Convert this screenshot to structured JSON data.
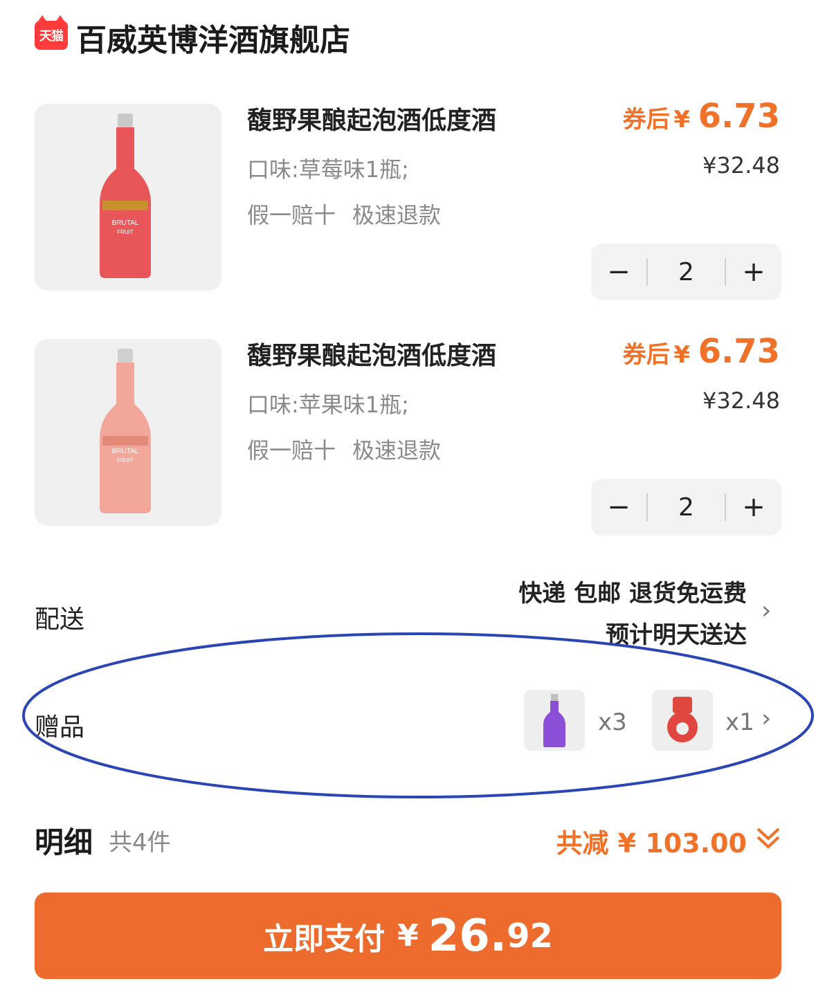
{
  "store": {
    "logo_text": "天猫",
    "name": "百威英博洋酒旗舰店"
  },
  "items": [
    {
      "title": "馥野果酿起泡酒低度酒",
      "flavor": "口味:草莓味1瓶;",
      "services": [
        "假一赔十",
        "极速退款"
      ],
      "coupon_label": "券后",
      "currency": "¥",
      "coupon_price": "6.73",
      "original_price": "¥32.48",
      "quantity": "2",
      "minus": "−",
      "plus": "+",
      "bottle_color": "#e8565a",
      "bottle_label": "BRUTAL"
    },
    {
      "title": "馥野果酿起泡酒低度酒",
      "flavor": "口味:苹果味1瓶;",
      "services": [
        "假一赔十",
        "极速退款"
      ],
      "coupon_label": "券后",
      "currency": "¥",
      "coupon_price": "6.73",
      "original_price": "¥32.48",
      "quantity": "2",
      "minus": "−",
      "plus": "+",
      "bottle_color": "#f2a79a",
      "bottle_label": "BRUTAL"
    }
  ],
  "delivery": {
    "label": "配送",
    "line1": "快递 包邮 退货免运费",
    "line2": "预计明天送达",
    "chevron": "›"
  },
  "gifts": {
    "label": "赠品",
    "items": [
      {
        "qty": "x3",
        "color": "#8a4fd6"
      },
      {
        "qty": "x1",
        "color": "#e0473f"
      }
    ],
    "chevron": "›"
  },
  "detail": {
    "title": "明细",
    "count": "共4件",
    "discount": "共减 ¥ 103.00"
  },
  "pay": {
    "label": "立即支付",
    "currency": "¥",
    "integer": "26.",
    "decimal": "92"
  },
  "colors": {
    "accent": "#ed6c2d",
    "price": "#f07228",
    "annotation_oval": "#2b45b5"
  }
}
